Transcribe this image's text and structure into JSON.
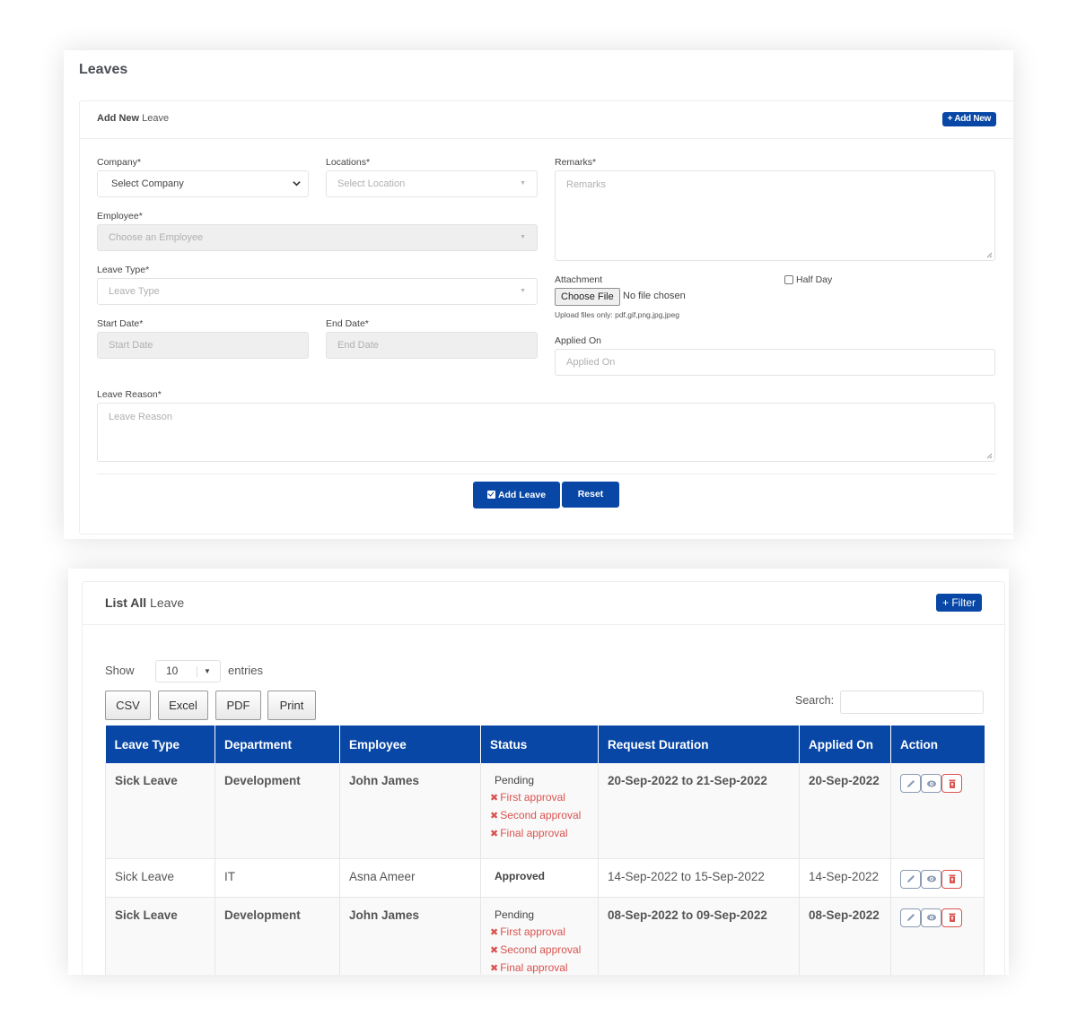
{
  "page": {
    "title": "Leaves"
  },
  "add_form": {
    "header": {
      "title_bold": "Add New",
      "title_rest": " Leave",
      "add_new_label": "+ Add New"
    },
    "company": {
      "label": "Company*",
      "value": "Select Company"
    },
    "locations": {
      "label": "Locations*",
      "placeholder": "Select Location"
    },
    "employee": {
      "label": "Employee*",
      "placeholder": "Choose an Employee"
    },
    "leave_type": {
      "label": "Leave Type*",
      "placeholder": "Leave Type"
    },
    "start_date": {
      "label": "Start Date*",
      "placeholder": "Start Date"
    },
    "end_date": {
      "label": "End Date*",
      "placeholder": "End Date"
    },
    "remarks": {
      "label": "Remarks*",
      "placeholder": "Remarks"
    },
    "attachment": {
      "label": "Attachment",
      "button": "Choose File",
      "status": "No file chosen",
      "hint": "Upload files only: pdf,gif,png,jpg,jpeg"
    },
    "half_day": {
      "label": "Half Day",
      "checked": false
    },
    "applied_on": {
      "label": "Applied On",
      "placeholder": "Applied On"
    },
    "leave_reason": {
      "label": "Leave Reason*",
      "placeholder": "Leave Reason"
    },
    "buttons": {
      "submit": "Add Leave",
      "reset": "Reset"
    }
  },
  "list": {
    "header": {
      "title_bold": "List All",
      "title_rest": " Leave",
      "filter_label": "+ Filter"
    },
    "show_label": "Show",
    "entries_label": "entries",
    "page_length": "10",
    "export_buttons": [
      "CSV",
      "Excel",
      "PDF",
      "Print"
    ],
    "search_label": "Search:",
    "search_value": "",
    "columns": [
      "Leave Type",
      "Department",
      "Employee",
      "Status",
      "Request Duration",
      "Applied On",
      "Action"
    ],
    "rows": [
      {
        "leave_type": "Sick Leave",
        "department": "Development",
        "employee": "John James",
        "status": "Pending",
        "approvals": [
          "First approval",
          "Second approval",
          "Final approval"
        ],
        "duration": "20-Sep-2022 to 21-Sep-2022",
        "applied_on": "20-Sep-2022"
      },
      {
        "leave_type": "Sick Leave",
        "department": "IT",
        "employee": "Asna Ameer",
        "status": "Approved",
        "approvals": [],
        "duration": "14-Sep-2022 to 15-Sep-2022",
        "applied_on": "14-Sep-2022"
      },
      {
        "leave_type": "Sick Leave",
        "department": "Development",
        "employee": "John James",
        "status": "Pending",
        "approvals": [
          "First approval",
          "Second approval",
          "Final approval"
        ],
        "duration": "08-Sep-2022 to 09-Sep-2022",
        "applied_on": "08-Sep-2022"
      }
    ],
    "approval_icon": "times-icon",
    "action_icons": [
      "pencil-icon",
      "eye-icon",
      "trash-icon"
    ]
  },
  "colors": {
    "primary": "#0847a6",
    "danger": "#d9534f",
    "action_border": "#8a9bb5"
  }
}
